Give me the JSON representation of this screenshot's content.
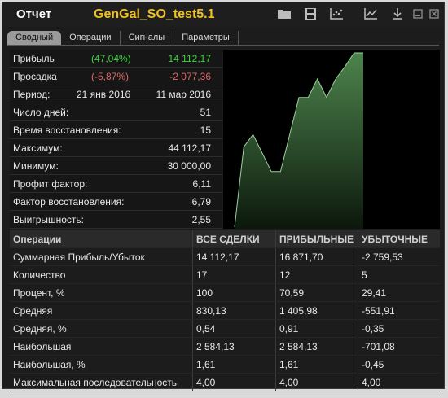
{
  "window": {
    "label": "Отчет",
    "name": "GenGal_SO_test5.1"
  },
  "tabs": [
    "Сводный",
    "Операции",
    "Сигналы",
    "Параметры"
  ],
  "stats": {
    "profit": {
      "label": "Прибыль",
      "pct": "(47,04%)",
      "value": "14 112,17"
    },
    "drawdown": {
      "label": "Просадка",
      "pct": "(-5,87%)",
      "value": "-2 077,36"
    },
    "period": {
      "label": "Период:",
      "from": "21 янв 2016",
      "to": "11 мар 2016"
    },
    "rows": [
      {
        "label": "Число дней:",
        "value": "51"
      },
      {
        "label": "Время восстановления:",
        "value": "15"
      },
      {
        "label": "Максимум:",
        "value": "44 112,17"
      },
      {
        "label": "Минимум:",
        "value": "30 000,00"
      },
      {
        "label": "Профит фактор:",
        "value": "6,11"
      },
      {
        "label": "Фактор восстановления:",
        "value": "6,79"
      },
      {
        "label": "Выигрышность:",
        "value": "2,55"
      }
    ]
  },
  "chart_data": {
    "type": "area",
    "values": [
      30000,
      36500,
      37500,
      36000,
      34500,
      34500,
      37500,
      40500,
      40500,
      42000,
      40500,
      42000,
      43000,
      44112,
      44112
    ],
    "color": "#5a9a5a"
  },
  "table": {
    "headers": [
      "Операции",
      "ВСЕ СДЕЛКИ",
      "ПРИБЫЛЬНЫЕ",
      "УБЫТОЧНЫЕ"
    ],
    "rows": [
      [
        "Суммарная Прибыль/Убыток",
        "14 112,17",
        "16 871,70",
        "-2 759,53"
      ],
      [
        "Количество",
        "17",
        "12",
        "5"
      ],
      [
        "Процент, %",
        "100",
        "70,59",
        "29,41"
      ],
      [
        "Средняя",
        "830,13",
        "1 405,98",
        "-551,91"
      ],
      [
        "Средняя, %",
        "0,54",
        "0,91",
        "-0,35"
      ],
      [
        "Наибольшая",
        "2 584,13",
        "2 584,13",
        "-701,08"
      ],
      [
        "Наибольшая, %",
        "1,61",
        "1,61",
        "-0,45"
      ],
      [
        "Максимальная последовательность",
        "4,00",
        "4,00",
        "4,00"
      ]
    ]
  },
  "colors": {
    "title": "#f0c020",
    "positive": "#3bd43b",
    "negative": "#e06565"
  }
}
